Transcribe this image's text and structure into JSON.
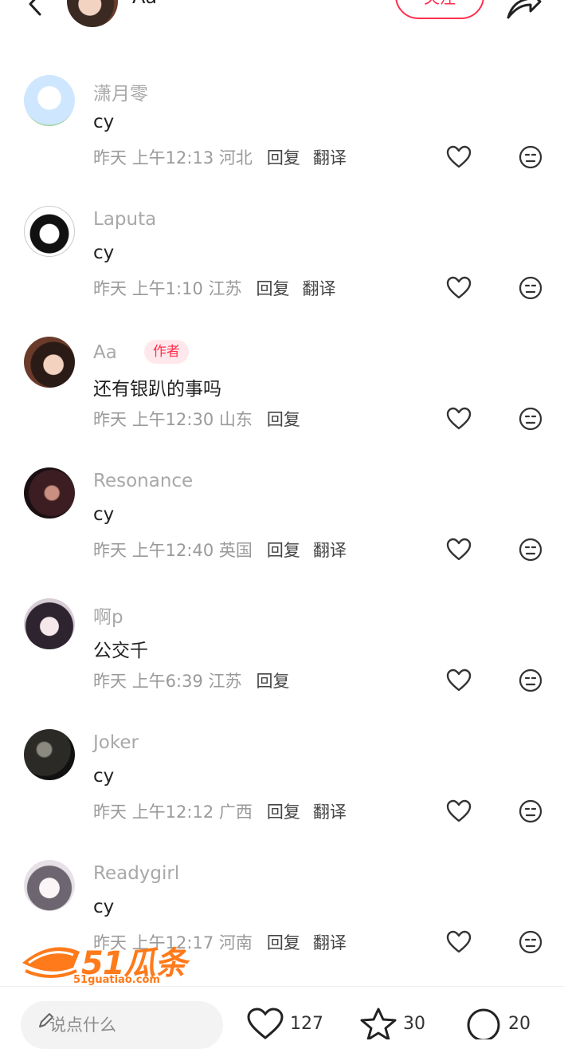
{
  "header": {
    "username": "Aa",
    "follow_label": "关注"
  },
  "comments": [
    {
      "username": "潇月零",
      "text": "cy",
      "date": "昨天",
      "time": "上午12:13",
      "location": "河北",
      "reply": "回复",
      "translate": "翻译",
      "avatar": "#cfe6ff"
    },
    {
      "username": "Laputa",
      "text": "cy",
      "date": "昨天",
      "time": "上午1:10",
      "location": "江苏",
      "reply": "回复",
      "translate": "翻译",
      "avatar": "#e9e9e9"
    },
    {
      "username": "Aa",
      "badge": "作者",
      "text": "还有银趴的事吗",
      "date": "昨天",
      "time": "上午12:30",
      "location": "山东",
      "reply": "回复",
      "avatar": "#5a2e22"
    },
    {
      "username": "Resonance",
      "text": "cy",
      "date": "昨天",
      "time": "上午12:40",
      "location": "英国",
      "reply": "回复",
      "translate": "翻译",
      "avatar": "#3b1d22"
    },
    {
      "username": "啊p",
      "text": "公交千",
      "date": "昨天",
      "time": "上午6:39",
      "location": "江苏",
      "reply": "回复",
      "avatar": "#d8cdd6"
    },
    {
      "username": "Joker",
      "text": "cy",
      "date": "昨天",
      "time": "上午12:12",
      "location": "广西",
      "reply": "回复",
      "translate": "翻译",
      "avatar": "#2b2a26"
    },
    {
      "username": "Readygirl",
      "text": "cy",
      "date": "昨天",
      "time": "上午12:17",
      "location": "河南",
      "reply": "回复",
      "translate": "翻译",
      "avatar": "#e6e1e6"
    }
  ],
  "watermark": {
    "main": "51瓜条",
    "sub": "51guatiao.com"
  },
  "bottom": {
    "input_placeholder": "说点什么",
    "likes": "127",
    "collects": "30",
    "comments": "20"
  },
  "colors": {
    "accent": "#ff2e4d",
    "meta": "#9a9a9a",
    "watermark": "#ff7a1a"
  }
}
